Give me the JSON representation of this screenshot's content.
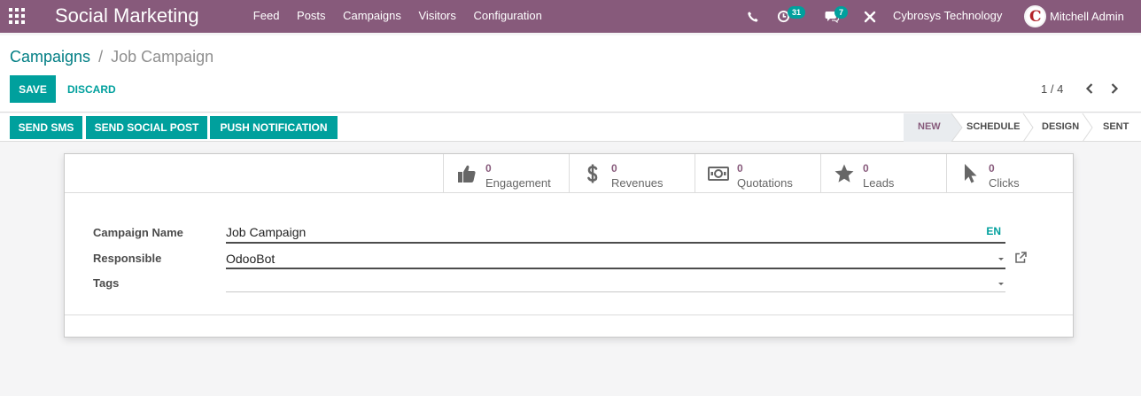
{
  "navbar": {
    "app_title": "Social Marketing",
    "menu": [
      "Feed",
      "Posts",
      "Campaigns",
      "Visitors",
      "Configuration"
    ],
    "activities_count": "31",
    "messages_count": "7",
    "company": "Cybrosys Technology",
    "user": "Mitchell Admin"
  },
  "breadcrumb": {
    "parent": "Campaigns",
    "separator": "/",
    "current": "Job Campaign"
  },
  "actions": {
    "save_label": "SAVE",
    "discard_label": "DISCARD"
  },
  "pager": {
    "value": "1 / 4"
  },
  "header_buttons": [
    "SEND SMS",
    "SEND SOCIAL POST",
    "PUSH NOTIFICATION"
  ],
  "stages": {
    "items": [
      "NEW",
      "SCHEDULE",
      "DESIGN",
      "SENT"
    ],
    "active": "NEW"
  },
  "stat_buttons": [
    {
      "value": "0",
      "label": "Engagement",
      "icon": "thumbs-up-icon"
    },
    {
      "value": "0",
      "label": "Revenues",
      "icon": "dollar-icon"
    },
    {
      "value": "0",
      "label": "Quotations",
      "icon": "money-bill-icon"
    },
    {
      "value": "0",
      "label": "Leads",
      "icon": "star-icon"
    },
    {
      "value": "0",
      "label": "Clicks",
      "icon": "pointer-icon"
    }
  ],
  "form": {
    "campaign_name": {
      "label": "Campaign Name",
      "value": "Job Campaign",
      "lang": "EN"
    },
    "responsible": {
      "label": "Responsible",
      "value": "OdooBot"
    },
    "tags": {
      "label": "Tags",
      "value": ""
    }
  },
  "colors": {
    "navbar": "#875a7b",
    "accent": "#00a09d",
    "link": "#017e84",
    "stat_value": "#875a7b"
  }
}
